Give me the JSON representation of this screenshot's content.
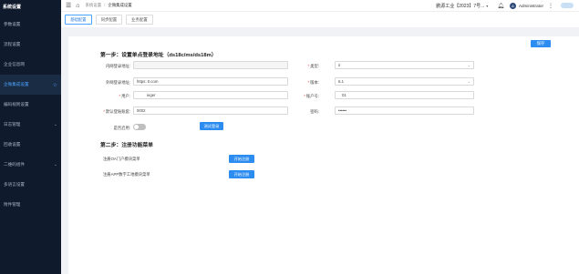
{
  "sidebar": {
    "title": "系统设置",
    "items": [
      {
        "label": "参数设置",
        "chevron": false
      },
      {
        "label": "流程设置",
        "chevron": false
      },
      {
        "label": "企业信息网",
        "chevron": false
      },
      {
        "label": "企微集成设置",
        "chevron": false,
        "active": true
      },
      {
        "label": "编码规则设置",
        "chevron": false
      },
      {
        "label": "日志管理",
        "chevron": true
      },
      {
        "label": "回收设置",
        "chevron": false
      },
      {
        "label": "二维码组件",
        "chevron": true
      },
      {
        "label": "多语言设置",
        "chevron": false
      },
      {
        "label": "附件管理",
        "chevron": false
      }
    ]
  },
  "topbar": {
    "breadcrumb_root": "系统设置",
    "breadcrumb_current": "企微集成设置",
    "factory": "鹏源工业【2023】7号...",
    "user": "Administrator"
  },
  "tabs": [
    "基础配置",
    "同步配置",
    "业务配置"
  ],
  "form": {
    "save_label": "保存",
    "step1_title": "第一步：设置单点登录地址（ds18c/ms/ds18m）",
    "fields": {
      "intranet_label": "内网登录地址:",
      "intranet_value": "",
      "type_label": "类型:",
      "type_value": "ir",
      "extranet_label": "外网登录地址:",
      "extranet_value": "https:            0.com",
      "version_label": "版本:",
      "version_value": "6.1",
      "user_label": "用户:",
      "user_value": "ieger",
      "account_label": "账户号:",
      "account_value": "01",
      "login_count_label": "默认登陆账套:",
      "login_count_value": "0002",
      "password_label": "密码:",
      "password_value": "••••••",
      "enable_label": "是否启用:"
    },
    "test_login_label": "测试登录",
    "step2_title": "第二步：注册功能菜单",
    "register_oa_label": "注册OA门户模块菜单",
    "register_app_label": "注册APP数字工地模块菜单",
    "start_register_label": "开始注册"
  }
}
